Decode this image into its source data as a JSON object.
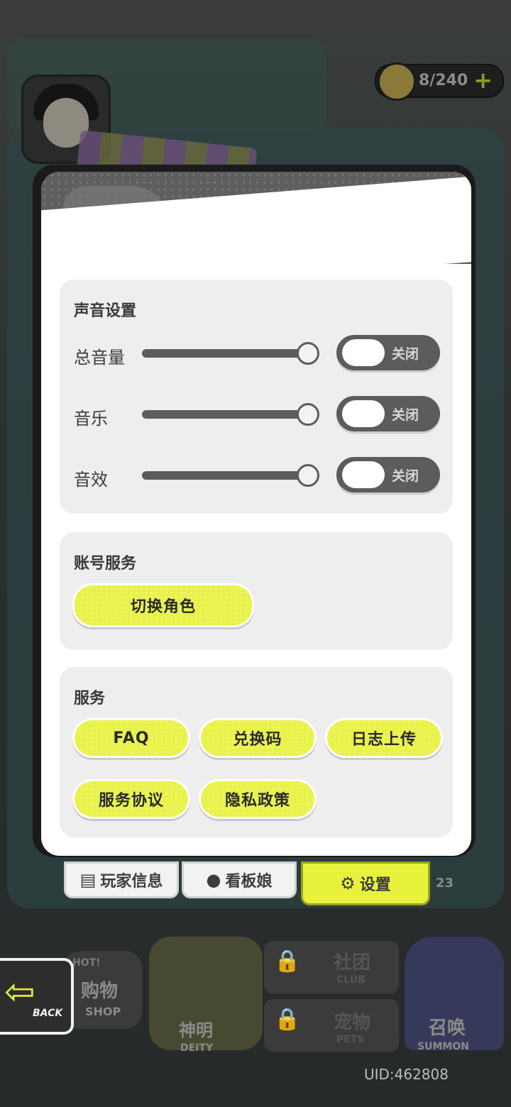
{
  "top_bar": {
    "stamina": "8/240",
    "plus": "+"
  },
  "settings": {
    "sound": {
      "title": "声音设置",
      "rows": [
        {
          "label": "总音量",
          "volume": 1.0,
          "toggle": "关闭"
        },
        {
          "label": "音乐",
          "volume": 1.0,
          "toggle": "关闭"
        },
        {
          "label": "音效",
          "volume": 1.0,
          "toggle": "关闭"
        }
      ]
    },
    "account": {
      "title": "账号服务",
      "switch_role": "切换角色"
    },
    "service": {
      "title": "服务",
      "buttons": [
        "FAQ",
        "兑换码",
        "日志上传",
        "服务协议",
        "隐私政策"
      ]
    }
  },
  "tabs": [
    {
      "label": "玩家信息",
      "icon": "id-card-icon"
    },
    {
      "label": "看板娘",
      "icon": "person-icon"
    },
    {
      "label": "设置",
      "icon": "gear-icon",
      "active": true
    }
  ],
  "tab_badge": "23",
  "bottom_nav": {
    "back": "BACK",
    "hot": "HOT!",
    "shop": "购物",
    "shop_en": "SHOP",
    "deity": "神明",
    "deity_en": "DEITY",
    "club": "社团",
    "club_en": "CLUB",
    "pets": "宠物",
    "pets_en": "PETS",
    "summon": "召唤",
    "summon_en": "SUMMON"
  },
  "uid": "UID:462808",
  "colors": {
    "accent": "#e9f24a",
    "panel": "#ffffff",
    "section": "#eeeeee",
    "toggle_off": "#5c5c5c"
  }
}
